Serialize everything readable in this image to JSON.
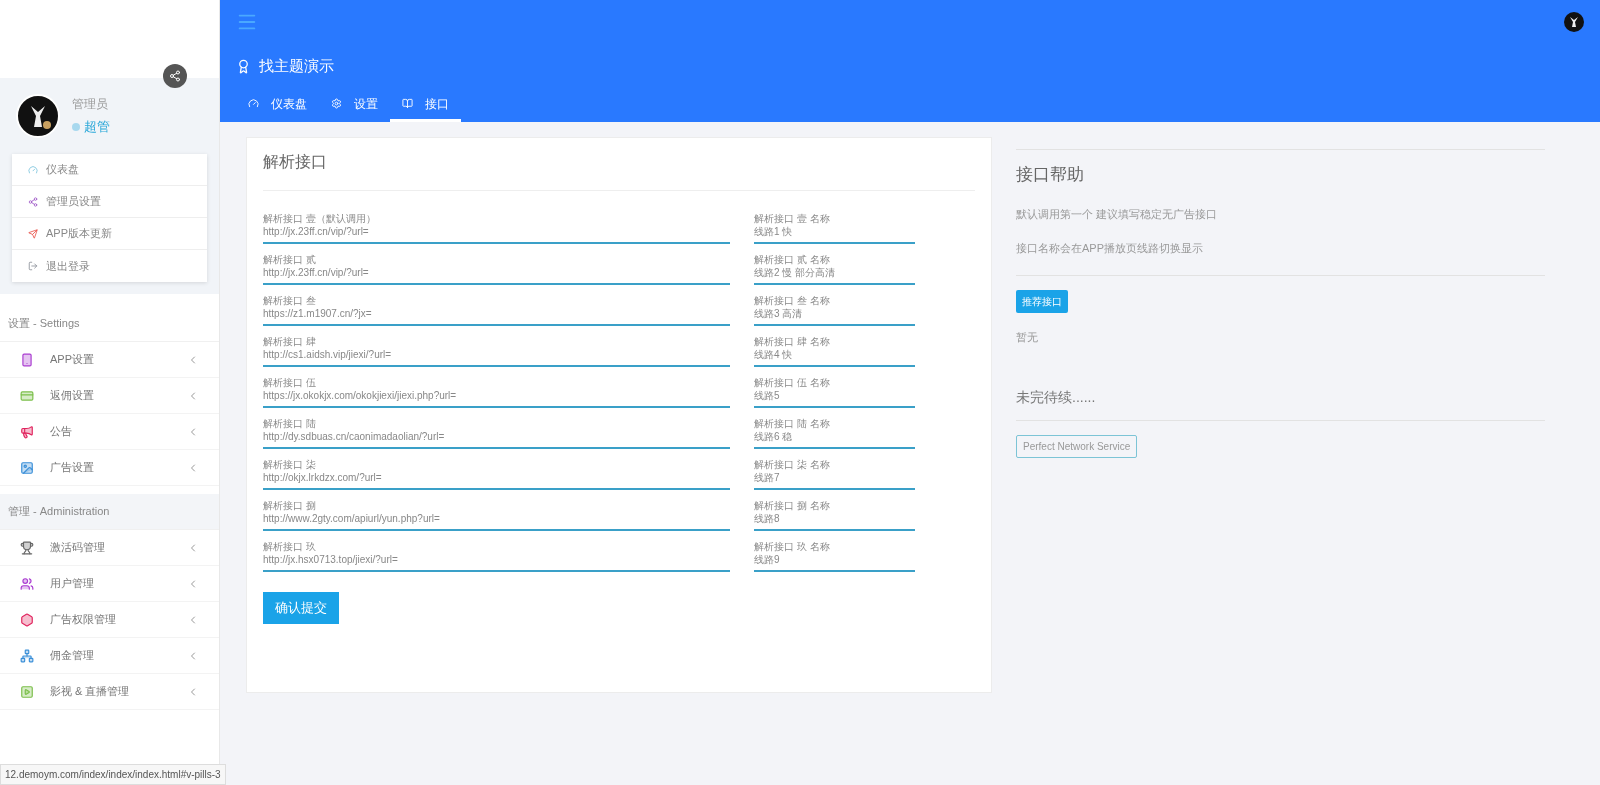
{
  "topbar": {
    "title": "找主题演示",
    "tabs": [
      {
        "label": "仪表盘",
        "selected": false
      },
      {
        "label": "设置",
        "selected": false
      },
      {
        "label": "接口",
        "selected": true
      }
    ]
  },
  "sidebar": {
    "user": {
      "name": "管理员",
      "role": "超管"
    },
    "quick_menu": [
      "仪表盘",
      "管理员设置",
      "APP版本更新",
      "退出登录"
    ],
    "sections": [
      {
        "title": "设置 - Settings",
        "items": [
          "APP设置",
          "返佣设置",
          "公告",
          "广告设置"
        ]
      },
      {
        "title": "管理 - Administration",
        "items": [
          "激活码管理",
          "用户管理",
          "广告权限管理",
          "佣金管理",
          "影视 & 直播管理"
        ]
      }
    ]
  },
  "form": {
    "title": "解析接口",
    "rows": [
      {
        "url_label": "解析接口 壹（默认调用）",
        "url": "http://jx.23ff.cn/vip/?url=",
        "name_label": "解析接口 壹 名称",
        "name": "线路1 快"
      },
      {
        "url_label": "解析接口 贰",
        "url": "http://jx.23ff.cn/vip/?url=",
        "name_label": "解析接口 贰 名称",
        "name": "线路2 慢 部分高清"
      },
      {
        "url_label": "解析接口 叁",
        "url": "https://z1.m1907.cn/?jx=",
        "name_label": "解析接口 叁 名称",
        "name": "线路3 高清"
      },
      {
        "url_label": "解析接口 肆",
        "url": "http://cs1.aidsh.vip/jiexi/?url=",
        "name_label": "解析接口 肆 名称",
        "name": "线路4 快"
      },
      {
        "url_label": "解析接口 伍",
        "url": "https://jx.okokjx.com/okokjiexi/jiexi.php?url=",
        "name_label": "解析接口 伍 名称",
        "name": "线路5"
      },
      {
        "url_label": "解析接口 陆",
        "url": "http://dy.sdbuas.cn/caonimadaolian/?url=",
        "name_label": "解析接口 陆 名称",
        "name": "线路6 稳"
      },
      {
        "url_label": "解析接口 柒",
        "url": "http://okjx.lrkdzx.com/?url=",
        "name_label": "解析接口 柒 名称",
        "name": "线路7"
      },
      {
        "url_label": "解析接口 捌",
        "url": "http://www.2gty.com/apiurl/yun.php?url=",
        "name_label": "解析接口 捌 名称",
        "name": "线路8"
      },
      {
        "url_label": "解析接口 玖",
        "url": "http://jx.hsx0713.top/jiexi/?url=",
        "name_label": "解析接口 玖 名称",
        "name": "线路9"
      }
    ],
    "submit": "确认提交"
  },
  "help": {
    "title": "接口帮助",
    "lines": [
      "默认调用第一个 建议填写稳定无广告接口",
      "接口名称会在APP播放页线路切换显示"
    ],
    "badge": "推荐接口",
    "badge_text": "暂无",
    "subtitle": "未完待续......",
    "footer_tag": "Perfect Network Service"
  },
  "status_bar": "12.demoym.com/index/index/index.html#v-pills-3"
}
